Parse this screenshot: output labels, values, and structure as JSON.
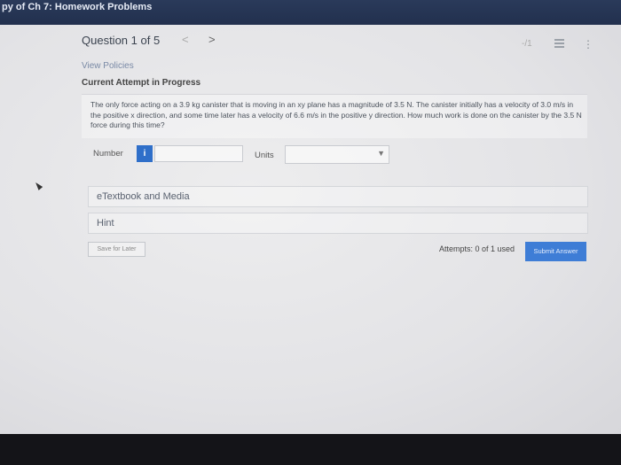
{
  "window": {
    "title": "py of Ch 7: Homework Problems"
  },
  "question": {
    "header": "Question 1 of 5",
    "prev_label": "<",
    "next_label": ">",
    "score": "-/1",
    "more_label": "⋮"
  },
  "policies": {
    "link": "View Policies"
  },
  "attempt": {
    "title": "Current Attempt in Progress"
  },
  "problem": {
    "text": "The only force acting on a 3.9 kg canister that is moving in an xy plane has a magnitude of 3.5 N. The canister initially has a velocity of 3.0 m/s in the positive x direction, and some time later has a velocity of 6.6 m/s in the positive y direction. How much work is done on the canister by the 3.5 N force during this time?"
  },
  "answer": {
    "number_label": "Number",
    "info_label": "i",
    "number_value": "",
    "units_label": "Units",
    "units_value": ""
  },
  "resources": {
    "etextbook_label": "eTextbook and Media",
    "hint_label": "Hint"
  },
  "footer": {
    "save_label": "Save for Later",
    "attempts_label": "Attempts: 0 of 1 used",
    "submit_label": "Submit Answer"
  },
  "colors": {
    "accent": "#2f6fc9",
    "submit": "#3e7dd6",
    "titlebar": "#2a3a5a"
  }
}
